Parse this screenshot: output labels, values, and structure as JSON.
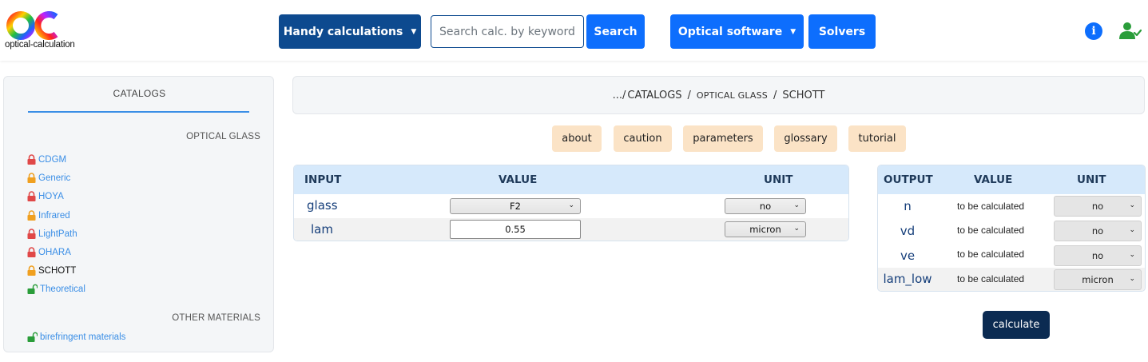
{
  "header": {
    "logo_text": "optical-calculation",
    "handy_label": "Handy calculations",
    "search_placeholder": "Search calc. by keywords...",
    "search_label": "Search",
    "optical_label": "Optical software",
    "solvers_label": "Solvers",
    "caret": "▼",
    "info_glyph": "i",
    "colors": {
      "dark_blue": "#0d4a8f",
      "blue": "#0d6efd",
      "green": "#2a9d3a"
    },
    "icons": [
      "logo",
      "info-icon",
      "user-check-icon"
    ]
  },
  "sidebar": {
    "title": "CATALOGS",
    "section1": "OPTICAL GLASS",
    "section2": "OTHER MATERIALS",
    "items": [
      {
        "label": "CDGM",
        "lock": "locked",
        "color": "#e04848"
      },
      {
        "label": "Generic",
        "lock": "locked",
        "color": "#f0a020"
      },
      {
        "label": "HOYA",
        "lock": "locked",
        "color": "#e04848"
      },
      {
        "label": "Infrared",
        "lock": "locked",
        "color": "#f0a020"
      },
      {
        "label": "LightPath",
        "lock": "locked",
        "color": "#e04848"
      },
      {
        "label": "OHARA",
        "lock": "locked",
        "color": "#e04848"
      },
      {
        "label": "SCHOTT",
        "lock": "locked",
        "color": "#f0a020",
        "active": true
      },
      {
        "label": "Theoretical",
        "lock": "unlocked",
        "color": "#2a9d3a"
      }
    ],
    "other_items": [
      {
        "label": "birefringent materials",
        "lock": "unlocked",
        "color": "#2a9d3a"
      }
    ]
  },
  "breadcrumb": {
    "root": ".../",
    "catalogs": "CATALOGS",
    "glass": "OPTICAL GLASS",
    "current": "SCHOTT",
    "sep": "/"
  },
  "tabs": [
    "about",
    "caution",
    "parameters",
    "glossary",
    "tutorial"
  ],
  "input_table": {
    "headers": [
      "INPUT",
      "VALUE",
      "UNIT"
    ],
    "rows": [
      {
        "label": "glass",
        "value": "F2",
        "unit": "no"
      },
      {
        "label": "lam",
        "value": "0.55",
        "unit": "micron"
      }
    ]
  },
  "output_table": {
    "headers": [
      "OUTPUT",
      "VALUE",
      "UNIT"
    ],
    "rows": [
      {
        "label": "n",
        "value": "to be calculated",
        "unit": "no"
      },
      {
        "label": "vd",
        "value": "to be calculated",
        "unit": "no"
      },
      {
        "label": "ve",
        "value": "to be calculated",
        "unit": "no"
      },
      {
        "label": "lam_low",
        "value": "to be calculated",
        "unit": "micron"
      }
    ]
  },
  "calculate_label": "calculate",
  "chevron": "⌄"
}
